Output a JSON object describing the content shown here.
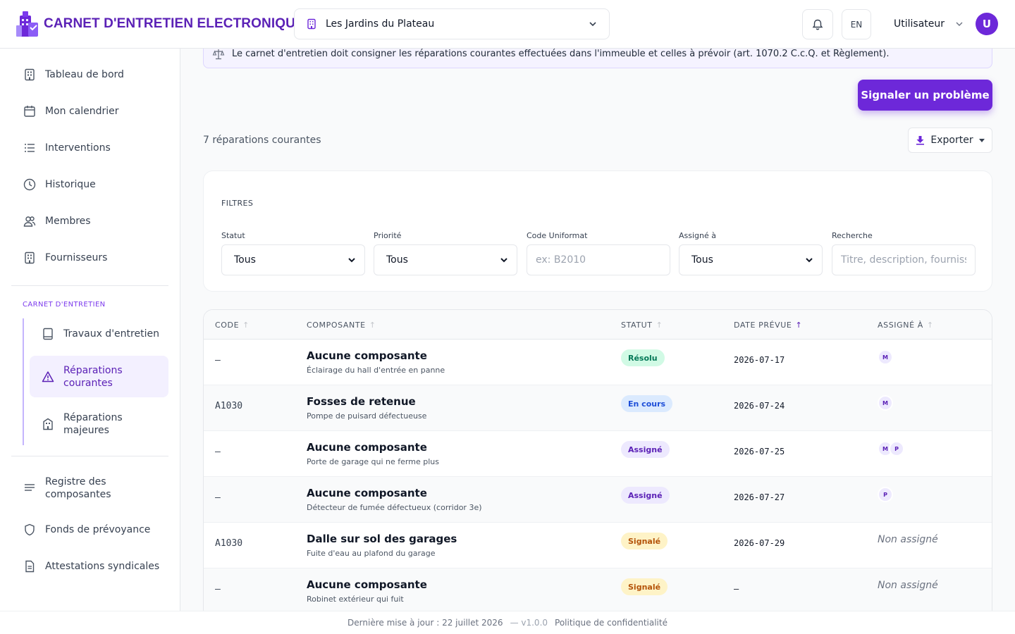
{
  "header": {
    "app_title": "CARNET D'ENTRETIEN ELECTRONIQUE",
    "building": "Les Jardins du Plateau",
    "lang": "EN",
    "user_name": "Utilisateur",
    "user_initial": "U"
  },
  "sidebar": {
    "items": [
      {
        "label": "Tableau de bord",
        "icon": "building-icon"
      },
      {
        "label": "Mon calendrier",
        "icon": "calendar-icon"
      },
      {
        "label": "Interventions",
        "icon": "list-icon"
      },
      {
        "label": "Historique",
        "icon": "clock-icon"
      },
      {
        "label": "Membres",
        "icon": "users-icon"
      },
      {
        "label": "Fournisseurs",
        "icon": "building-icon"
      }
    ],
    "section_label": "CARNET D'ENTRETIEN",
    "sub_items": [
      {
        "label": "Travaux d'entretien",
        "icon": "book-icon"
      },
      {
        "label_1": "Réparations",
        "label_2": "courantes",
        "icon": "warning-icon",
        "active": true
      },
      {
        "label_1": "Réparations",
        "label_2": "majeures",
        "icon": "building-icon"
      }
    ],
    "bottom_items": [
      {
        "label_1": "Registre des",
        "label_2": "composantes",
        "icon": "lines-icon"
      },
      {
        "label": "Fonds de prévoyance",
        "icon": "shield-icon"
      },
      {
        "label": "Attestations syndicales",
        "icon": "document-icon"
      }
    ]
  },
  "main": {
    "banner": "Le carnet d'entretien doit consigner les réparations courantes effectuées dans l'immeuble et celles à prévoir (art. 1070.2 C.c.Q. et Règlement).",
    "report_button": "Signaler un problème",
    "count": "7 réparations courantes",
    "export_button": "Exporter",
    "filters": {
      "title": "FILTRES",
      "statut": {
        "label": "Statut",
        "value": "Tous"
      },
      "priorite": {
        "label": "Priorité",
        "value": "Tous"
      },
      "code": {
        "label": "Code Uniformat",
        "placeholder": "ex: B2010"
      },
      "assigne": {
        "label": "Assigné à",
        "value": "Tous"
      },
      "recherche": {
        "label": "Recherche",
        "placeholder": "Titre, description, fournisseur..."
      }
    },
    "table": {
      "headers": [
        "CODE",
        "COMPOSANTE",
        "STATUT",
        "DATE PRÉVUE",
        "ASSIGNÉ À"
      ],
      "sorted_column": "DATE PRÉVUE",
      "rows": [
        {
          "code": "–",
          "title": "Aucune composante",
          "desc": "Éclairage du hall d'entrée en panne",
          "status": "Résolu",
          "date": "2026-07-17",
          "assignees": [
            "M"
          ]
        },
        {
          "code": "A1030",
          "title": "Fosses de retenue",
          "desc": "Pompe de puisard défectueuse",
          "status": "En cours",
          "date": "2026-07-24",
          "assignees": [
            "M"
          ]
        },
        {
          "code": "–",
          "title": "Aucune composante",
          "desc": "Porte de garage qui ne ferme plus",
          "status": "Assigné",
          "date": "2026-07-25",
          "assignees": [
            "M",
            "P"
          ]
        },
        {
          "code": "–",
          "title": "Aucune composante",
          "desc": "Détecteur de fumée défectueux (corridor 3e)",
          "status": "Assigné",
          "date": "2026-07-27",
          "assignees": [
            "P"
          ]
        },
        {
          "code": "A1030",
          "title": "Dalle sur sol des garages",
          "desc": "Fuite d'eau au plafond du garage",
          "status": "Signalé",
          "date": "2026-07-29",
          "unassigned": "Non assigné"
        },
        {
          "code": "–",
          "title": "Aucune composante",
          "desc": "Robinet extérieur qui fuit",
          "status": "Signalé",
          "date": "–",
          "unassigned": "Non assigné"
        }
      ]
    }
  },
  "footer": {
    "updated": "Dernière mise à jour : 22 juillet 2026",
    "version": "— v1.0.0",
    "privacy": "Politique de confidentialité"
  },
  "colors": {
    "accent": "#6d28d9",
    "status_resolu_bg": "#d1fae5",
    "status_resolu_fg": "#047857",
    "status_encours_bg": "#dbeafe",
    "status_encours_fg": "#1d4ed8",
    "status_assigne_bg": "#ede9fe",
    "status_assigne_fg": "#5b21b6",
    "status_signale_bg": "#fef3c7",
    "status_signale_fg": "#b45309"
  }
}
